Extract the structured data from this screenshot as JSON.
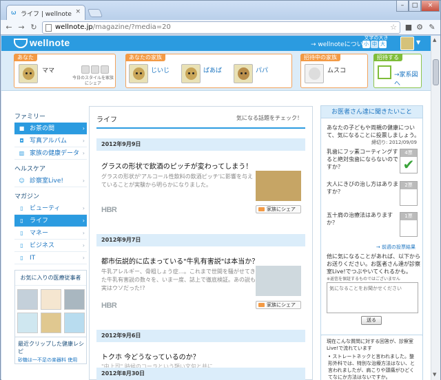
{
  "browser": {
    "tab_title": "ライフ | wellnote",
    "url_host": "wellnote.jp",
    "url_path": "/magazine/?media=20"
  },
  "header": {
    "logo": "wellnote",
    "about_link": "wellnoteについて",
    "font_size_label": "文字の大きさ",
    "font_sizes": [
      "小",
      "中",
      "大"
    ]
  },
  "family": {
    "me_tag": "あなた",
    "me_name": "ママ",
    "me_note": "今日のスタイルを家族にシェア",
    "family_tag": "あなたの家族",
    "members": [
      "じいじ",
      "ばあば",
      "パパ"
    ],
    "inviting_tag": "招待中の家族",
    "inviting_name": "ムスコ",
    "invite_tag": "招待する",
    "invite_link": "家系図へ"
  },
  "sidebar": {
    "section1": "ファミリー",
    "family_items": [
      "お茶の間",
      "写真アルバム",
      "家族の健康データ"
    ],
    "section2": "ヘルスケア",
    "health_items": [
      "診察室Live!"
    ],
    "section3": "マガジン",
    "magazine_items": [
      "ビューティ",
      "ライフ",
      "マネー",
      "ビジネス",
      "IT"
    ],
    "fav_title": "お気に入りの医療従事者",
    "recent_title": "最近クリップした健康レシピ",
    "recent_sub": "砂糖は一不足の楽器料 使用"
  },
  "main": {
    "title": "ライフ",
    "tagline": "気になる話題をチェック！",
    "share_label": "家族にシェア",
    "articles": [
      {
        "date": "2012年9月9日",
        "title": "グラスの形状で飲酒のピッチが変わってしまう！",
        "body": "グラスの形状が'アルコール性飲料の飲酒ピッチ'に影響を与えていることが実験から明らかになりました。",
        "source": "HBR"
      },
      {
        "date": "2012年9月7日",
        "title": "都市伝説的に広まっている\"牛乳有害説\"は本当か？",
        "body": "牛乳アレルギー、骨粗しょう症…。これまで世間を騒がせてきた牛乳有害説の数々を、いま一度、誌上で徹底検証。あの説も実はウソだった!?",
        "source": "HBR"
      },
      {
        "date": "2012年9月6日",
        "title": "トクホ 今どうなっているのか？",
        "body": "\"中上司\" 時候のコーラという類い文句と共に",
        "source": ""
      },
      {
        "date": "2012年8月30日",
        "title": "",
        "body": "",
        "source": ""
      }
    ]
  },
  "right_panel": {
    "header": "お医者さん達に聞きたいこと",
    "intro": "あなたの子どもや両親の健康について、気になることに投票しましょう。",
    "period": "締切り: 2012/09/09",
    "questions": [
      {
        "text": "乳歯にフッ素コーティングすると絶対虫歯にならないのですか？",
        "votes": "4票"
      },
      {
        "text": "大人にきびの治し方はありますか？",
        "votes": "2票"
      },
      {
        "text": "五十肩の治療法はありますか？",
        "votes": "1票"
      }
    ],
    "past_link": "前週の投票結果",
    "ask_text": "他に気になることがあれば、以下からお送りください。お医者さん達が診察室Live!でつぶやいてくれるかも。",
    "note": "※返信を保証するものではございません",
    "placeholder": "気になることをお聞かせください",
    "send": "送る"
  },
  "right_panel2": {
    "text": "現在こんな質問に対する回答が、診察室Live!で流れています",
    "bullet": "ストレートネックと言われました。整形外科では、特別な治療方法はない、と言われましたが、肩こりや頭痛がひどくてなにか方法はないですか。"
  }
}
